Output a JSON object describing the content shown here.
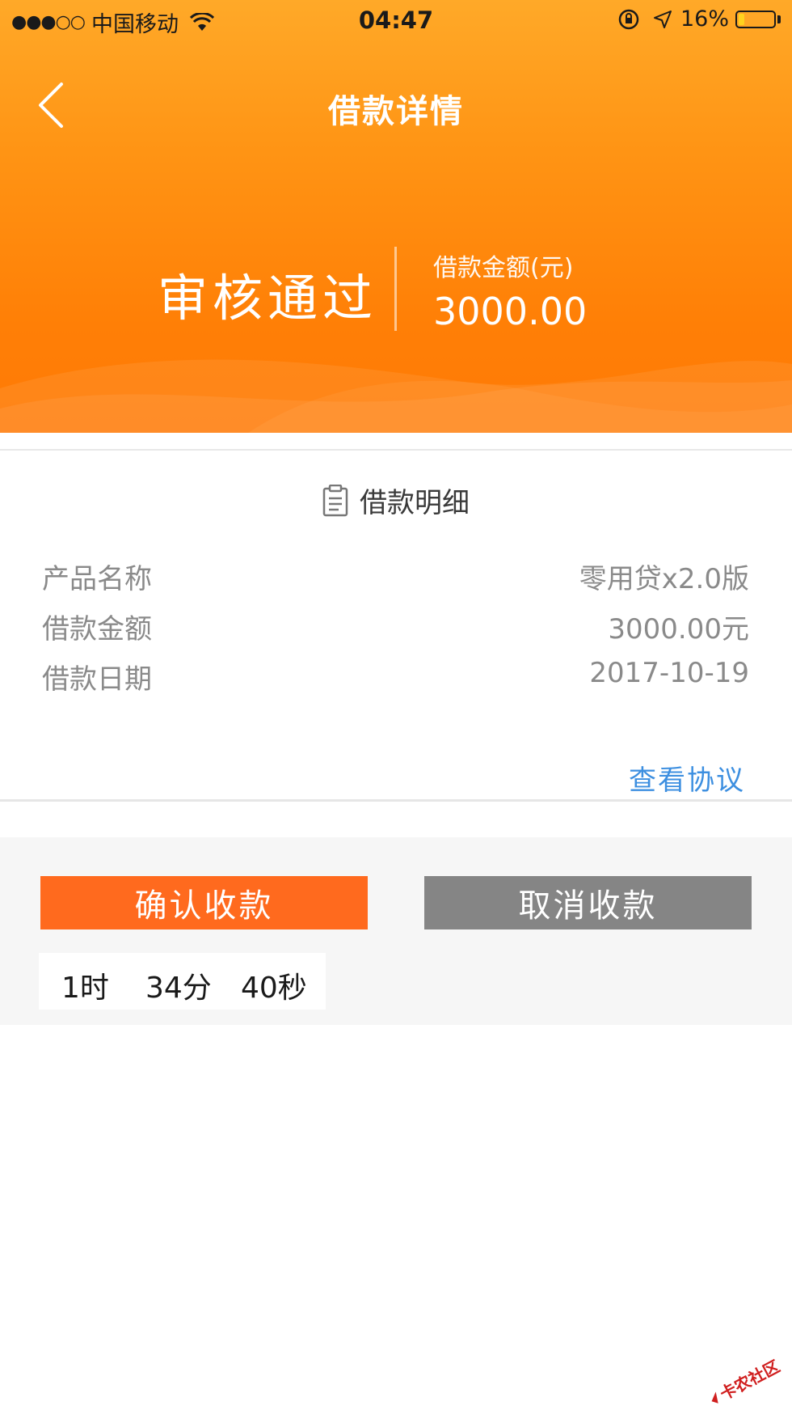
{
  "status_bar": {
    "signal": "●●●○○",
    "carrier": "中国移动",
    "time": "04:47",
    "battery": "16%",
    "battery_level": 0.16
  },
  "nav": {
    "title": "借款详情"
  },
  "loan_summary": {
    "status": "审核通过",
    "amount_label": "借款金额(元)",
    "amount_value": "3000.00"
  },
  "details": {
    "title": "借款明细",
    "rows": [
      {
        "label": "产品名称",
        "value": "零用贷x2.0版"
      },
      {
        "label": "借款金额",
        "value": "3000.00元"
      },
      {
        "label": "借款日期",
        "value": "2017-10-19"
      }
    ],
    "agreement_link": "查看协议"
  },
  "actions": {
    "confirm_label": "确认收款",
    "cancel_label": "取消收款"
  },
  "countdown": {
    "hours": "1时",
    "minutes": "34分",
    "seconds": "40秒"
  },
  "watermark": {
    "text": "卡农社区"
  },
  "colors": {
    "header_top": "#ffa928",
    "header_bottom": "#ff7a05",
    "confirm_button": "#ff6a1e",
    "cancel_button": "#858585",
    "link": "#3d8fe0"
  }
}
